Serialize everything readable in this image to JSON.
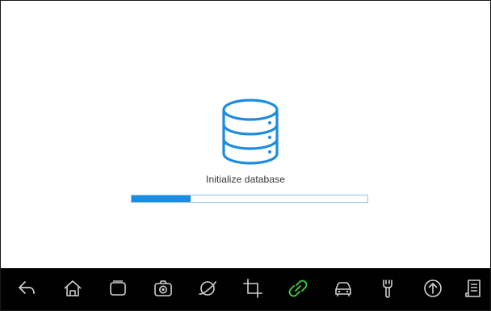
{
  "loading": {
    "message": "Initialize database",
    "progress_percent": 25
  },
  "colors": {
    "accent": "#1b8ce0",
    "track_border": "#8fc3ea",
    "navbar_bg": "#000000",
    "nav_icon": "#d0d0d0",
    "nav_icon_active": "#3dd63d"
  },
  "navbar": {
    "items": [
      {
        "icon": "back-icon"
      },
      {
        "icon": "home-icon"
      },
      {
        "icon": "recent-apps-icon"
      },
      {
        "icon": "camera-icon"
      },
      {
        "icon": "browser-icon"
      },
      {
        "icon": "crop-icon"
      },
      {
        "icon": "link-icon",
        "active": true
      },
      {
        "icon": "car-icon"
      },
      {
        "icon": "wrench-icon"
      },
      {
        "icon": "upload-icon"
      },
      {
        "icon": "document-icon"
      }
    ]
  }
}
